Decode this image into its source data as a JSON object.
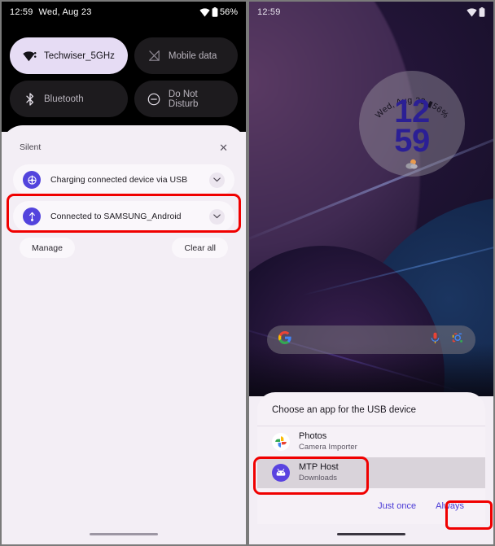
{
  "left_phone": {
    "status_bar": {
      "time": "12:59",
      "date": "Wed, Aug 23",
      "wifi_icon": "wifi-icon",
      "battery_icon": "battery-icon",
      "battery_text": "56%"
    },
    "quick_settings": {
      "tiles": [
        {
          "label": "Techwiser_5GHz",
          "icon": "wifi-icon",
          "state": "on"
        },
        {
          "label": "Mobile data",
          "icon": "mobile-data-off-icon",
          "state": "off"
        },
        {
          "label": "Bluetooth",
          "icon": "bluetooth-icon",
          "state": "off"
        },
        {
          "label": "Do Not Disturb",
          "icon": "do-not-disturb-icon",
          "state": "off"
        }
      ]
    },
    "shade": {
      "section_label": "Silent",
      "close_icon": "close-icon",
      "notifications": [
        {
          "text": "Charging connected device via USB",
          "icon": "usb-charging-icon",
          "expand_icon": "chevron-down-icon",
          "highlighted": false
        },
        {
          "text": "Connected to SAMSUNG_Android",
          "icon": "usb-icon",
          "expand_icon": "chevron-down-icon",
          "highlighted": true
        }
      ],
      "manage_label": "Manage",
      "clear_all_label": "Clear all"
    },
    "gesture_bar": "home-gesture-bar"
  },
  "right_phone": {
    "status_bar": {
      "time": "12:59",
      "wifi_icon": "wifi-icon",
      "battery_icon": "battery-icon"
    },
    "clock_widget": {
      "date_text": "Wed, Aug 23",
      "battery_text": "56%",
      "battery_icon": "battery-icon",
      "hours": "12",
      "minutes": "59",
      "weather_icon": "partly-cloudy-icon"
    },
    "search_bar": {
      "google_icon": "google-g-icon",
      "mic_icon": "microphone-icon",
      "lens_icon": "google-lens-icon",
      "placeholder": ""
    },
    "usb_dialog": {
      "title": "Choose an app for the USB device",
      "apps": [
        {
          "name": "Photos",
          "subtitle": "Camera Importer",
          "icon": "google-photos-icon",
          "selected": false,
          "highlighted": false
        },
        {
          "name": "MTP Host",
          "subtitle": "Downloads",
          "icon": "android-robot-icon",
          "selected": true,
          "highlighted": true
        }
      ],
      "just_once_label": "Just once",
      "always_label": "Always"
    },
    "gesture_bar": "home-gesture-bar"
  },
  "annotations": {
    "highlight_color": "#f00000",
    "boxes": [
      {
        "target": "notification-connected-to-samsung"
      },
      {
        "target": "app-row-mtp-host"
      },
      {
        "target": "always-button"
      }
    ]
  },
  "theme": {
    "accent": "#5344dd",
    "clock_color": "#2b1f95",
    "dialog_button_color": "#4b3bd6",
    "tile_on_bg": "#e6dcf4",
    "tile_off_bg": "#1d1b1e",
    "shade_bg": "#f3eef5"
  }
}
